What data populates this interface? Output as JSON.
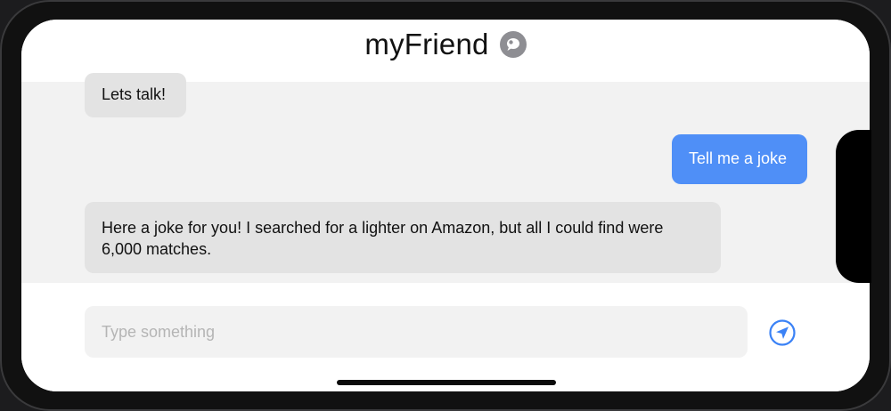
{
  "header": {
    "title": "myFriend",
    "icon": "chat-bubble-icon"
  },
  "messages": [
    {
      "sender": "bot",
      "text": "Lets talk!"
    },
    {
      "sender": "user",
      "text": "Tell me a joke"
    },
    {
      "sender": "bot",
      "text": "Here a joke for you! I searched for a lighter on Amazon, but all I could find were 6,000 matches."
    }
  ],
  "composer": {
    "placeholder": "Type something",
    "value": "",
    "send_icon": "send-icon"
  },
  "colors": {
    "accent": "#4f8ff7",
    "bot_bubble": "#e3e3e3",
    "chat_bg": "#f2f2f2"
  }
}
